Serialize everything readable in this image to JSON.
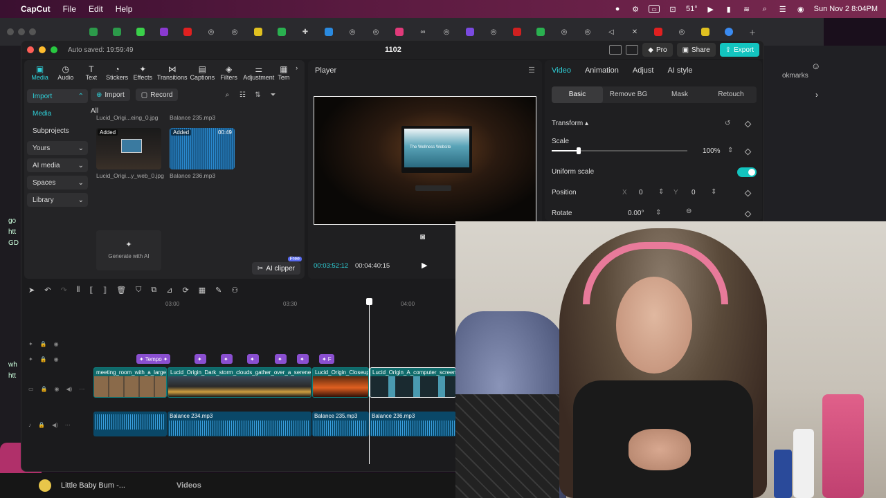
{
  "menubar": {
    "app_name": "CapCut",
    "menus": [
      "File",
      "Edit",
      "Help"
    ],
    "weather": "51°",
    "datetime": "Sun Nov 2  8:04PM"
  },
  "window": {
    "autosave": "Auto saved: 19:59:49",
    "title": "1102",
    "pro_label": "Pro",
    "share_label": "Share",
    "export_label": "Export"
  },
  "tool_tabs": [
    {
      "label": "Media",
      "icon": "media-icon"
    },
    {
      "label": "Audio",
      "icon": "audio-icon"
    },
    {
      "label": "Text",
      "icon": "text-icon"
    },
    {
      "label": "Stickers",
      "icon": "stickers-icon"
    },
    {
      "label": "Effects",
      "icon": "effects-icon"
    },
    {
      "label": "Transitions",
      "icon": "transitions-icon"
    },
    {
      "label": "Captions",
      "icon": "captions-icon"
    },
    {
      "label": "Filters",
      "icon": "filters-icon"
    },
    {
      "label": "Adjustment",
      "icon": "adjustment-icon"
    },
    {
      "label": "Tem",
      "icon": "templates-icon"
    }
  ],
  "media_nav": {
    "import": "Import",
    "media": "Media",
    "subprojects": "Subprojects",
    "yours": "Yours",
    "ai_media": "AI media",
    "spaces": "Spaces",
    "library": "Library"
  },
  "media_toolbar": {
    "import_btn": "Import",
    "record_btn": "Record",
    "all_label": "All"
  },
  "assets": [
    {
      "caption": "Lucid_Origi...eing_0.jpg",
      "badge": "",
      "duration": ""
    },
    {
      "caption": "Balance 235.mp3",
      "badge": "",
      "duration": ""
    },
    {
      "caption": "Lucid_Origi...y_web_0.jpg",
      "badge": "Added",
      "duration": ""
    },
    {
      "caption": "Balance 236.mp3",
      "badge": "Added",
      "duration": "00:49"
    }
  ],
  "generate_ai": "Generate with AI",
  "ai_clipper": {
    "label": "AI clipper",
    "badge": "Free"
  },
  "player": {
    "title": "Player",
    "current_time": "00:03:52:12",
    "total_time": "00:04:40:15",
    "screen_text": "The Wellness Website"
  },
  "props": {
    "tabs": [
      "Video",
      "Animation",
      "Adjust",
      "AI style"
    ],
    "subtabs": [
      "Basic",
      "Remove BG",
      "Mask",
      "Retouch"
    ],
    "transform_label": "Transform",
    "scale_label": "Scale",
    "scale_value": "100%",
    "scale_fraction": 0.2,
    "uniform_scale_label": "Uniform scale",
    "position_label": "Position",
    "pos_x_label": "X",
    "pos_x": "0",
    "pos_y_label": "Y",
    "pos_y": "0",
    "rotate_label": "Rotate",
    "rotate_value": "0.00°"
  },
  "timeline": {
    "ruler": [
      "03:00",
      "03:30",
      "04:00"
    ],
    "effect_chips": [
      "Tempo",
      "",
      "",
      "",
      "",
      "",
      "F"
    ],
    "video_clips": [
      "meeting_room_with_a_large_wi",
      "Lucid_Origin_Dark_storm_clouds_gather_over_a_serene_su",
      "Lucid_Origin_Closeup",
      "Lucid_Origin_A_computer_screen_c"
    ],
    "audio_clips": [
      "",
      "Balance 234.mp3",
      "Balance 235.mp3",
      "Balance 236.mp3"
    ]
  },
  "browser": {
    "bottom_text": "Little Baby Bum -...",
    "bottom_overlay": "Videos",
    "side_text": "okmarks",
    "left_texts": [
      "go",
      "htt",
      "GD",
      "wh",
      "htt"
    ]
  },
  "colors": {
    "accent": "#13c4bf",
    "accent_text": "#2fd0d8",
    "effect": "#8a4fd0",
    "video_clip": "#0f6b6b",
    "audio_clip": "#0a4868"
  }
}
